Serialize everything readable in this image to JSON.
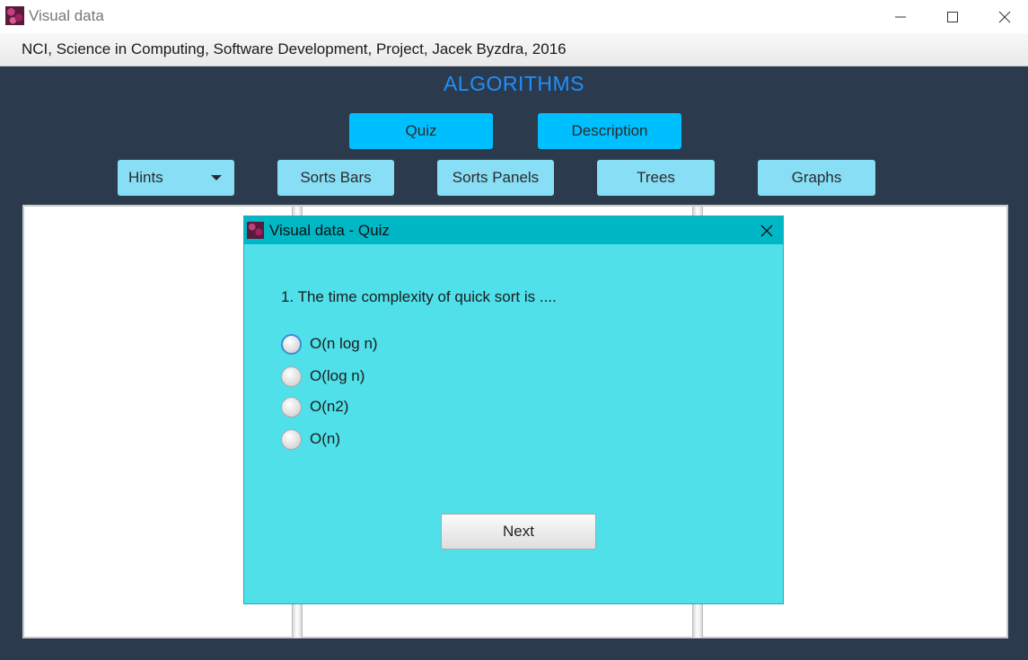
{
  "window": {
    "title": "Visual data",
    "controls": {
      "minimize": "minimize-icon",
      "maximize": "maximize-icon",
      "close": "close-icon"
    }
  },
  "menubar": {
    "text": "NCI, Science in Computing, Software Development, Project, Jacek Byzdra, 2016"
  },
  "heading": "ALGORITHMS",
  "toolbar": {
    "primary": [
      {
        "label": "Quiz"
      },
      {
        "label": "Description"
      }
    ],
    "nav": [
      {
        "label": "Hints"
      },
      {
        "label": "Sorts Bars"
      },
      {
        "label": "Sorts Panels"
      },
      {
        "label": "Trees"
      },
      {
        "label": "Graphs"
      }
    ]
  },
  "dialog": {
    "title": "Visual data - Quiz",
    "question": "1. The time complexity of quick sort is ....",
    "options": [
      {
        "label": "O(n log n)"
      },
      {
        "label": "O(log n)"
      },
      {
        "label": "O(n2)"
      },
      {
        "label": "O(n)"
      }
    ],
    "next_label": "Next"
  },
  "colors": {
    "background": "#2c3a4d",
    "accent_heading": "#1e90ff",
    "primary_button": "#00bfff",
    "nav_button": "#87def5",
    "dialog_bg": "#4fe0ea",
    "dialog_titlebar": "#00b7c6"
  }
}
